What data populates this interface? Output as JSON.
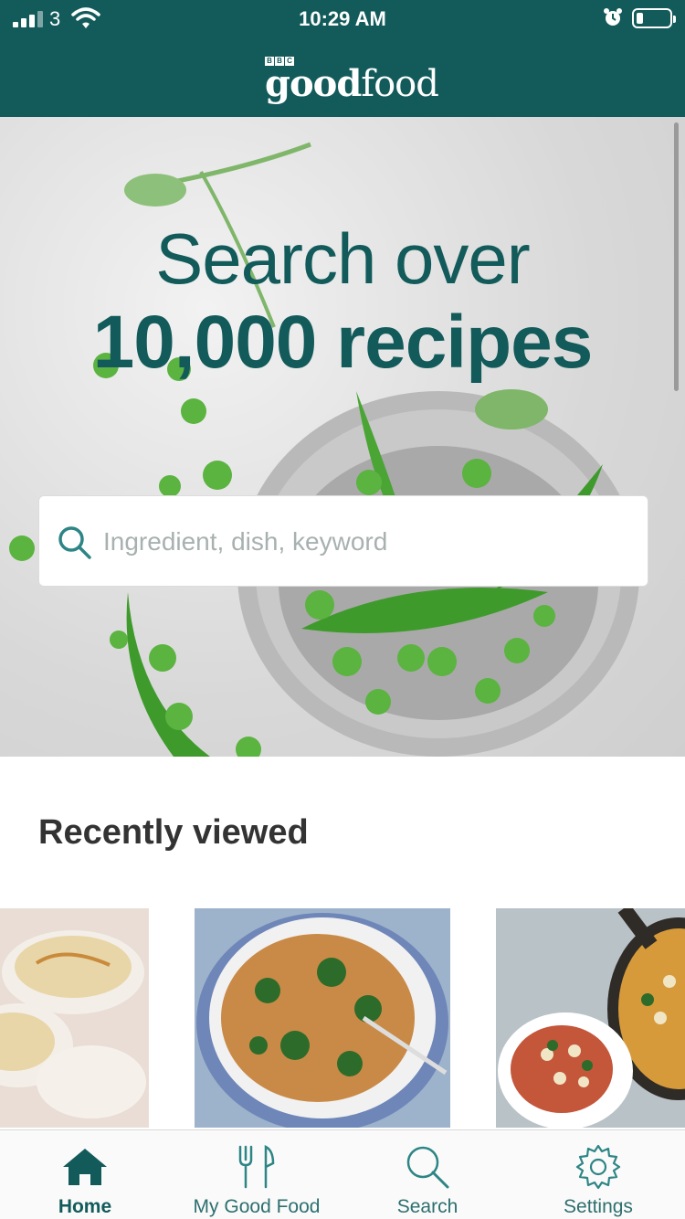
{
  "status_bar": {
    "carrier": "3",
    "time": "10:29 AM",
    "icons": [
      "signal-icon",
      "wifi-icon",
      "alarm-icon",
      "battery-icon"
    ]
  },
  "header": {
    "logo_badge": [
      "B",
      "B",
      "C"
    ],
    "logo_bold": "good",
    "logo_regular": "food",
    "background_color": "#135b5b"
  },
  "hero": {
    "line1": "Search over",
    "line2": "10,000 recipes",
    "search_placeholder": "Ingredient, dish, keyword",
    "search_icon": "search-icon"
  },
  "recently_viewed": {
    "title": "Recently viewed",
    "items": [
      {
        "image": "noodle-soup-bowls"
      },
      {
        "image": "pasta-with-greens-bowl"
      },
      {
        "image": "bean-and-sausage-stew"
      }
    ]
  },
  "tab_bar": {
    "tabs": [
      {
        "label": "Home",
        "icon": "home-icon",
        "active": true
      },
      {
        "label": "My Good Food",
        "icon": "cutlery-icon",
        "active": false
      },
      {
        "label": "Search",
        "icon": "search-icon",
        "active": false
      },
      {
        "label": "Settings",
        "icon": "gear-icon",
        "active": false
      }
    ]
  },
  "colors": {
    "brand_teal": "#135b5b",
    "tab_label": "#2e6f6f",
    "heading_text": "#333333"
  }
}
